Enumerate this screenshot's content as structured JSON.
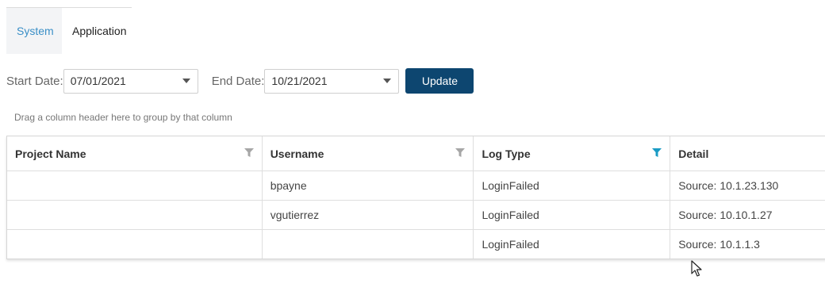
{
  "tabs": [
    {
      "label": "System",
      "active": true
    },
    {
      "label": "Application",
      "active": false
    }
  ],
  "filters": {
    "start_label": "Start Date:",
    "start_value": "07/01/2021",
    "end_label": "End Date:",
    "end_value": "10/21/2021",
    "update_label": "Update"
  },
  "group_hint": "Drag a column header here to group by that column",
  "grid": {
    "columns": [
      "Project Name",
      "Username",
      "Log Type",
      "Detail"
    ],
    "rows": [
      {
        "project": "",
        "username": "bpayne",
        "log_type": "LoginFailed",
        "detail": "Source: 10.1.23.130"
      },
      {
        "project": "",
        "username": "vgutierrez",
        "log_type": "LoginFailed",
        "detail": "Source: 10.10.1.27"
      },
      {
        "project": "",
        "username": "",
        "log_type": "LoginFailed",
        "detail": "Source: 10.1.1.3"
      }
    ]
  },
  "icons": {
    "filter_inactive_color": "#a6a6a6",
    "filter_active_color": "#1a9bc4"
  }
}
